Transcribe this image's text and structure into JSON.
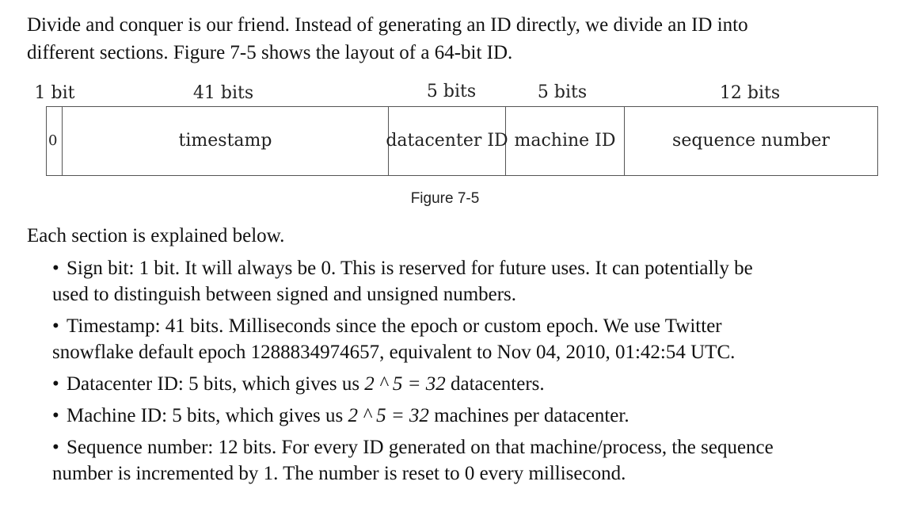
{
  "intro": {
    "line1": "Divide and conquer is our friend. Instead of generating an ID directly, we divide an ID into",
    "line2": "different sections. Figure 7-5 shows the layout of a 64-bit ID."
  },
  "figure": {
    "bit_labels": {
      "sign": "1 bit",
      "timestamp": "41 bits",
      "datacenter": "5 bits",
      "machine": "5 bits",
      "sequence": "12 bits"
    },
    "cells": {
      "sign": "0",
      "timestamp": "timestamp",
      "datacenter": "datacenter ID",
      "machine": "machine ID",
      "sequence": "sequence number"
    },
    "caption": "Figure 7-5"
  },
  "section_intro": "Each section is explained below.",
  "bullets": {
    "sign": {
      "line1": "Sign bit: 1 bit. It will always be 0. This is reserved for future uses. It can potentially be",
      "line2": "used to distinguish between signed and unsigned numbers."
    },
    "timestamp": {
      "line1": "Timestamp: 41 bits. Milliseconds since the epoch or custom epoch. We use Twitter",
      "line2": "snowflake default epoch 1288834974657, equivalent to Nov 04, 2010, 01:42:54 UTC."
    },
    "datacenter": {
      "before": "Datacenter ID: 5 bits, which gives us ",
      "math": "2 ^ 5 = 32",
      "after": " datacenters."
    },
    "machine": {
      "before": "Machine ID: 5 bits, which gives us ",
      "math": "2 ^ 5 = 32",
      "after": " machines per datacenter."
    },
    "sequence": {
      "line1": "Sequence number: 12 bits. For every ID generated on that machine/process, the sequence",
      "line2": "number is incremented by 1. The number is reset to 0 every millisecond."
    }
  }
}
